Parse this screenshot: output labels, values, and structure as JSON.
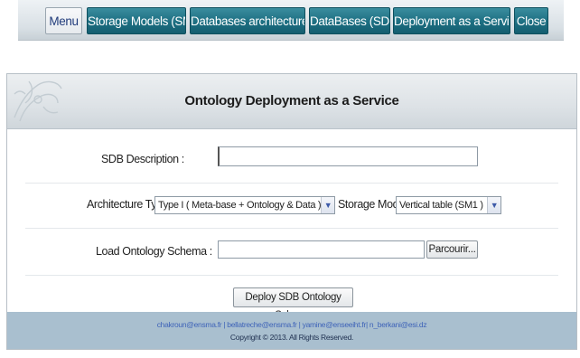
{
  "menu": {
    "items": [
      {
        "label": "Menu",
        "active": true
      },
      {
        "label": "Storage Models (SM)"
      },
      {
        "label": "Databases architectures"
      },
      {
        "label": "DataBases (SDB)"
      },
      {
        "label": "Deployment as a Service"
      },
      {
        "label": "Close"
      }
    ]
  },
  "panel": {
    "title": "Ontology Deployment as a Service"
  },
  "form": {
    "sdb_description_label": "SDB Description :",
    "sdb_description_value": "",
    "architecture_type_label": "Architecture Type :",
    "architecture_type_value": "Type I ( Meta-base + Ontology & Data )",
    "storage_model_label": "Storage Model :",
    "storage_model_value": "Vertical table (SM1 )",
    "load_schema_label": "Load Ontology Schema :",
    "load_schema_value": "",
    "browse_label": "Parcourir...",
    "deploy_label": "Deploy SDB Ontology Schema"
  },
  "footer": {
    "emails": "chakroun@ensma.fr | bellatreche@ensma.fr | yamine@enseeiht.fr| n_berkani@esi.dz",
    "copyright": "Copyright © 2013. All Rights Reserved."
  },
  "colors": {
    "menu_tab": "#1d6f82",
    "menu_active_text": "#1f3a7a",
    "footer_bg": "#a9bfcf",
    "footer_email": "#3e63b8"
  }
}
